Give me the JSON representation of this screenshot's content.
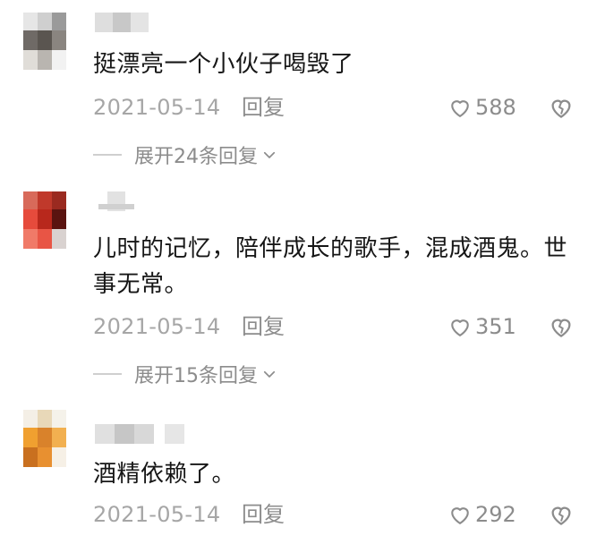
{
  "comments": [
    {
      "text": "挺漂亮一个小伙子喝毁了",
      "date": "2021-05-14",
      "reply_label": "回复",
      "likes": "588",
      "expand_label": "展开24条回复",
      "icons": {
        "like": "heart-outline-icon",
        "dislike": "broken-heart-icon",
        "expand": "chevron-down-icon"
      }
    },
    {
      "text": "儿时的记忆，陪伴成长的歌手，混成酒鬼。世事无常。",
      "date": "2021-05-14",
      "reply_label": "回复",
      "likes": "351",
      "expand_label": "展开15条回复",
      "icons": {
        "like": "heart-outline-icon",
        "dislike": "broken-heart-icon",
        "expand": "chevron-down-icon"
      }
    },
    {
      "text": "酒精依赖了。",
      "date": "2021-05-14",
      "reply_label": "回复",
      "likes": "292",
      "icons": {
        "like": "heart-outline-icon",
        "dislike": "broken-heart-icon"
      }
    }
  ],
  "colors": {
    "text": "#161616",
    "meta": "#a6a6a6",
    "action": "#8c8c8c",
    "divider": "#cfcfcf",
    "background": "#ffffff"
  }
}
